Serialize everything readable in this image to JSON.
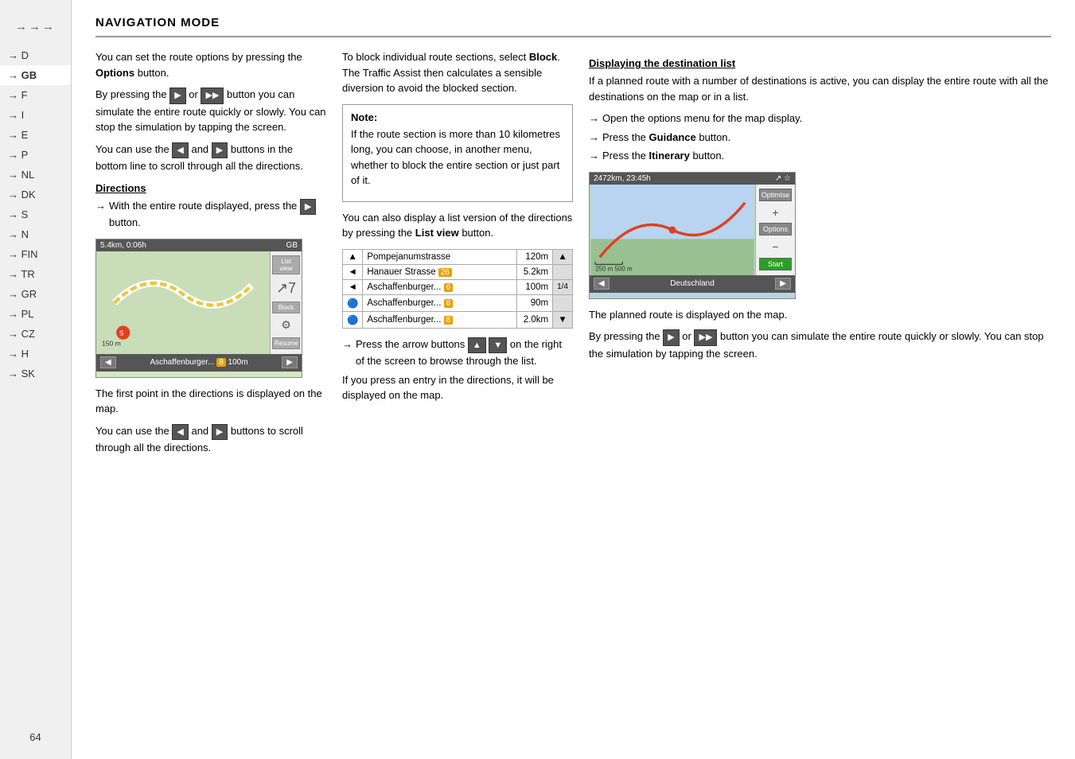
{
  "sidebar": {
    "header": "→→→",
    "items": [
      {
        "label": "→ D",
        "active": false
      },
      {
        "label": "→ GB",
        "active": true
      },
      {
        "label": "→ F",
        "active": false
      },
      {
        "label": "→ I",
        "active": false
      },
      {
        "label": "→ E",
        "active": false
      },
      {
        "label": "→ P",
        "active": false
      },
      {
        "label": "→ NL",
        "active": false
      },
      {
        "label": "→ DK",
        "active": false
      },
      {
        "label": "→ S",
        "active": false
      },
      {
        "label": "→ N",
        "active": false
      },
      {
        "label": "→ FIN",
        "active": false
      },
      {
        "label": "→ TR",
        "active": false
      },
      {
        "label": "→ GR",
        "active": false
      },
      {
        "label": "→ PL",
        "active": false
      },
      {
        "label": "→ CZ",
        "active": false
      },
      {
        "label": "→ H",
        "active": false
      },
      {
        "label": "→ SK",
        "active": false
      }
    ],
    "page_number": "64"
  },
  "page": {
    "title": "NAVIGATION MODE"
  },
  "col_left": {
    "para1": "You can set the route options by pressing the ",
    "para1_bold": "Options",
    "para1_end": " button.",
    "para2_start": "By pressing the ",
    "para2_end": " button you can simulate the entire route quickly or slowly. You can stop the simulation by tapping the screen.",
    "para3_start": "You can use the ",
    "para3_end": " and ",
    "para3_end2": " buttons in the bottom line to scroll through all the directions.",
    "section_directions": "Directions",
    "arrow1_start": "→ With the entire route displayed, press the ",
    "arrow1_end": " button.",
    "map_topbar_left": "5.4km, 0:06h",
    "map_topbar_right": "GB",
    "map_btn1": "List view",
    "map_btn2": "Block",
    "map_btn3": "Resume",
    "map_dist": "150 m",
    "map_bottom_label": "Aschaffenburger...",
    "map_bottom_num": "8",
    "map_bottom_dist": "100m",
    "para4": "The first point in the directions is displayed on the map.",
    "para5_start": "You can use the ",
    "para5_and": " and ",
    "para5_end": " buttons to scroll through all the directions."
  },
  "col_middle": {
    "para1_start": "To block individual route sections, select ",
    "para1_bold": "Block",
    "para1_end": ". The Traffic Assist then calculates a sensible diversion to avoid the blocked section.",
    "note_title": "Note:",
    "note_text": "If the route section is more than 10 kilometres long, you can choose, in another menu, whether to block the entire section or just part of it.",
    "para2_start": "You can also display a list version of the directions by pressing the ",
    "para2_bold": "List view",
    "para2_end": " button.",
    "route_rows": [
      {
        "icon": "▲",
        "street": "Pompejanumstrasse",
        "badge": "",
        "dist": "120m",
        "scroll": "▲",
        "frac": ""
      },
      {
        "icon": "◄",
        "street": "Hanauer Strasse",
        "badge": "26",
        "dist": "5.2km",
        "scroll": "",
        "frac": ""
      },
      {
        "icon": "◄",
        "street": "Aschaffenburger...",
        "badge": "6",
        "dist": "100m",
        "scroll": "",
        "frac": "1/4"
      },
      {
        "icon": "◉",
        "street": "Aschaffenburger...",
        "badge": "8",
        "dist": "90m",
        "scroll": "",
        "frac": ""
      },
      {
        "icon": "◉",
        "street": "Aschaffenburger...",
        "badge": "8",
        "dist": "2.0km",
        "scroll": "▼",
        "frac": ""
      }
    ],
    "arrow2_start": "→ Press the arrow buttons ",
    "arrow2_mid": " on the right of the screen to browse through the list.",
    "para3": "If you press an entry in the directions, it will be displayed on the map."
  },
  "col_right": {
    "section_heading": "Displaying the destination list",
    "para1": "If a planned route with a number of destinations is active, you can display the entire route with all the destinations on the map or in a list.",
    "arrow1": "→ Open the options menu for the map display.",
    "arrow2_start": "→ Press the ",
    "arrow2_bold": "Guidance",
    "arrow2_end": " button.",
    "arrow3_start": "→ Press the ",
    "arrow3_bold": "Itinerary",
    "arrow3_end": " button.",
    "nav_map_topbar_left": "2472km, 23:45h",
    "nav_map_topbar_right": "↗☆",
    "nav_btn1": "Optimise",
    "nav_btn2": "Options",
    "nav_btn3": "Start",
    "nav_scale": "250 m  500 m",
    "nav_bottom_left": "◄",
    "nav_bottom_label": "Deutschland",
    "nav_bottom_right": "►",
    "para2": "The planned route is displayed on the map.",
    "para3_start": "By pressing the ",
    "para3_end": " button you can simulate the entire route quickly or slowly. You can stop the simulation by tapping the screen."
  }
}
